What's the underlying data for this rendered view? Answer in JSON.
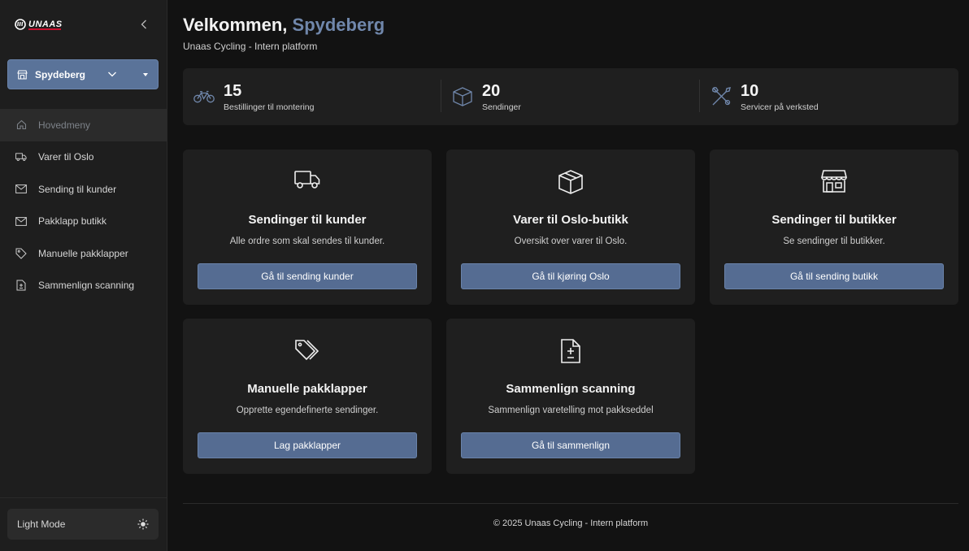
{
  "sidebar": {
    "logo_text": "UNAAS",
    "store": "Spydeberg",
    "items": [
      {
        "label": "Hovedmeny",
        "icon": "home-icon"
      },
      {
        "label": "Varer til Oslo",
        "icon": "truck-icon"
      },
      {
        "label": "Sending til kunder",
        "icon": "mail-icon"
      },
      {
        "label": "Pakklapp butikk",
        "icon": "mail-icon"
      },
      {
        "label": "Manuelle pakklapper",
        "icon": "tag-icon"
      },
      {
        "label": "Sammenlign scanning",
        "icon": "file-diff-icon"
      }
    ],
    "light_mode": "Light Mode"
  },
  "header": {
    "welcome": "Velkommen,",
    "store": "Spydeberg",
    "subtitle": "Unaas Cycling - Intern platform"
  },
  "stats": [
    {
      "value": "15",
      "label": "Bestillinger til montering",
      "icon": "bike-icon"
    },
    {
      "value": "20",
      "label": "Sendinger",
      "icon": "box-icon"
    },
    {
      "value": "10",
      "label": "Servicer på verksted",
      "icon": "tools-icon"
    }
  ],
  "cards": [
    {
      "title": "Sendinger til kunder",
      "desc": "Alle ordre som skal sendes til kunder.",
      "button": "Gå til sending kunder",
      "icon": "truck-icon"
    },
    {
      "title": "Varer til Oslo-butikk",
      "desc": "Oversikt over varer til Oslo.",
      "button": "Gå til kjøring Oslo",
      "icon": "box-icon"
    },
    {
      "title": "Sendinger til butikker",
      "desc": "Se sendinger til butikker.",
      "button": "Gå til sending butikk",
      "icon": "store-icon"
    },
    {
      "title": "Manuelle pakklapper",
      "desc": "Opprette egendefinerte sendinger.",
      "button": "Lag pakklapper",
      "icon": "tags-icon"
    },
    {
      "title": "Sammenlign scanning",
      "desc": "Sammenlign varetelling mot pakkseddel",
      "button": "Gå til sammenlign",
      "icon": "file-diff-icon"
    }
  ],
  "footer": "© 2025 Unaas Cycling - Intern platform",
  "colors": {
    "accent": "#5a7399",
    "accent_text": "#7087ab",
    "background": "#121212",
    "panel": "#1f1f1f"
  }
}
